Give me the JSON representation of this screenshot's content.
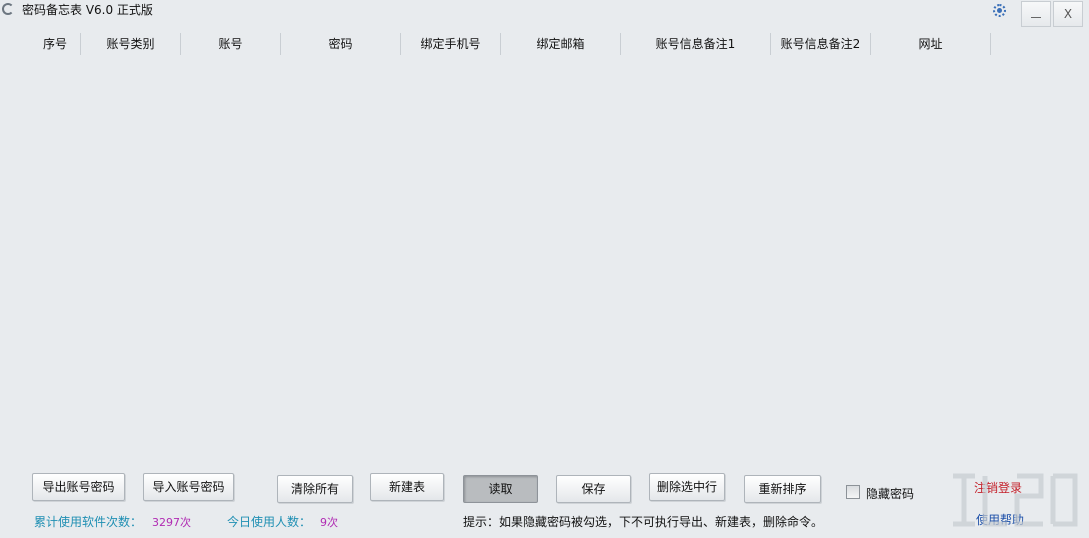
{
  "window": {
    "title": "密码备忘表 V6.0 正式版",
    "close_label": "X"
  },
  "table": {
    "columns": [
      "序号",
      "账号类别",
      "账号",
      "密码",
      "绑定手机号",
      "绑定邮箱",
      "账号信息备注1",
      "账号信息备注2",
      "网址"
    ],
    "rows": []
  },
  "toolbar": {
    "export_label": "导出账号密码",
    "import_label": "导入账号密码",
    "clear_label": "清除所有",
    "new_label": "新建表",
    "read_label": "读取",
    "save_label": "保存",
    "delete_label": "删除选中行",
    "sort_label": "重新排序",
    "hide_password_label": "隐藏密码",
    "hide_password_checked": false,
    "logout_label": "注销登录",
    "help_label": "使用帮助"
  },
  "status": {
    "total_label": "累计使用软件次数：",
    "total_value": "3297次",
    "today_label": "今日使用人数：",
    "today_value": "9次",
    "hint": "提示：如果隐藏密码被勾选，下不可执行导出、新建表，删除命令。"
  },
  "colors": {
    "background": "#e8ebee",
    "stat_label": "#1f8fb3",
    "stat_value": "#b02bb3",
    "logout": "#c4202a",
    "help": "#1c4fa8"
  },
  "icons": {
    "app": "app-icon",
    "settings": "settings-icon"
  }
}
